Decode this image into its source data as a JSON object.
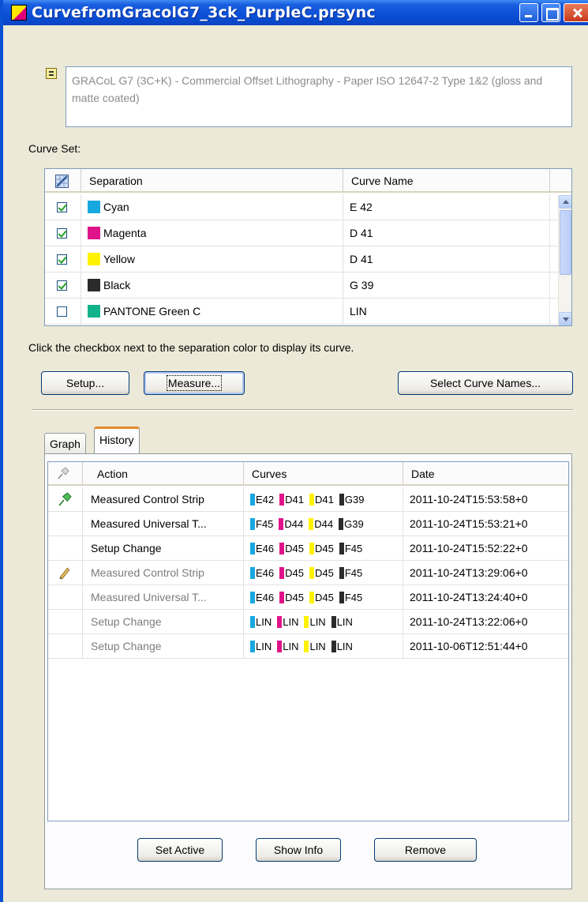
{
  "window": {
    "title": "CurvefromGracolG7_3ck_PurpleC.prsync"
  },
  "description": "GRACoL G7 (3C+K) - Commercial Offset Lithography - Paper ISO 12647-2 Type 1&2 (gloss and matte coated)",
  "curve_set": {
    "label": "Curve Set:",
    "columns": {
      "separation": "Separation",
      "curve_name": "Curve Name"
    },
    "rows": [
      {
        "checked": true,
        "name": "Cyan",
        "color": "#18a8e0",
        "curve": "E 42"
      },
      {
        "checked": true,
        "name": "Magenta",
        "color": "#e0138a",
        "curve": "D 41"
      },
      {
        "checked": true,
        "name": "Yellow",
        "color": "#fff200",
        "curve": "D 41"
      },
      {
        "checked": true,
        "name": "Black",
        "color": "#2b2b2b",
        "curve": "G 39"
      },
      {
        "checked": false,
        "name": "PANTONE Green C",
        "color": "#12b28a",
        "curve": "LIN"
      }
    ],
    "hint": "Click the checkbox next to the separation color to display its curve."
  },
  "buttons": {
    "setup": "Setup...",
    "measure": "Measure...",
    "select_curve_names": "Select Curve Names..."
  },
  "tabs": {
    "graph": "Graph",
    "history": "History"
  },
  "history": {
    "columns": {
      "action": "Action",
      "curves": "Curves",
      "date": "Date"
    },
    "colors": [
      "#18a8e0",
      "#e0138a",
      "#fff200",
      "#2b2b2b"
    ],
    "rows": [
      {
        "icon": "pin-icon",
        "action": "Measured Control Strip",
        "active": true,
        "curves": [
          "E42",
          "D41",
          "D41",
          "G39"
        ],
        "date": "2011-10-24T15:53:58+0"
      },
      {
        "icon": "",
        "action": "Measured Universal T...",
        "active": true,
        "curves": [
          "F45",
          "D44",
          "D44",
          "G39"
        ],
        "date": "2011-10-24T15:53:21+0"
      },
      {
        "icon": "",
        "action": "Setup Change",
        "active": true,
        "curves": [
          "E46",
          "D45",
          "D45",
          "F45"
        ],
        "date": "2011-10-24T15:52:22+0"
      },
      {
        "icon": "pencil-icon",
        "action": "Measured Control Strip",
        "active": false,
        "curves": [
          "E46",
          "D45",
          "D45",
          "F45"
        ],
        "date": "2011-10-24T13:29:06+0"
      },
      {
        "icon": "",
        "action": "Measured Universal T...",
        "active": false,
        "curves": [
          "E46",
          "D45",
          "D45",
          "F45"
        ],
        "date": "2011-10-24T13:24:40+0"
      },
      {
        "icon": "",
        "action": "Setup Change",
        "active": false,
        "curves": [
          "LIN",
          "LIN",
          "LIN",
          "LIN"
        ],
        "date": "2011-10-24T13:22:06+0"
      },
      {
        "icon": "",
        "action": "Setup Change",
        "active": false,
        "curves": [
          "LIN",
          "LIN",
          "LIN",
          "LIN"
        ],
        "date": "2011-10-06T12:51:44+0"
      }
    ],
    "buttons": {
      "set_active": "Set Active",
      "show_info": "Show Info",
      "remove": "Remove"
    }
  }
}
